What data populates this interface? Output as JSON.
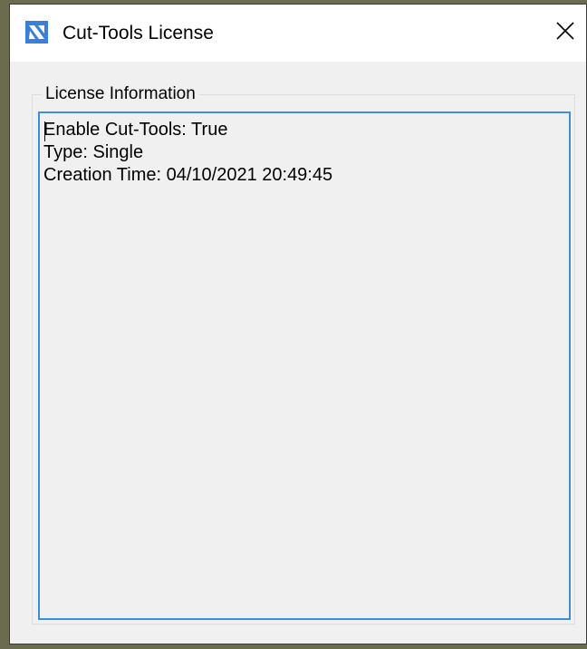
{
  "window": {
    "title": "Cut-Tools License",
    "app_icon": "bricscad-logo-icon",
    "close_icon": "close-icon",
    "accent_color": "#3c8fd8"
  },
  "group": {
    "label": "License Information",
    "lines": [
      "Enable Cut-Tools: True",
      "Type: Single",
      "Creation Time: 04/10/2021 20:49:45"
    ]
  }
}
